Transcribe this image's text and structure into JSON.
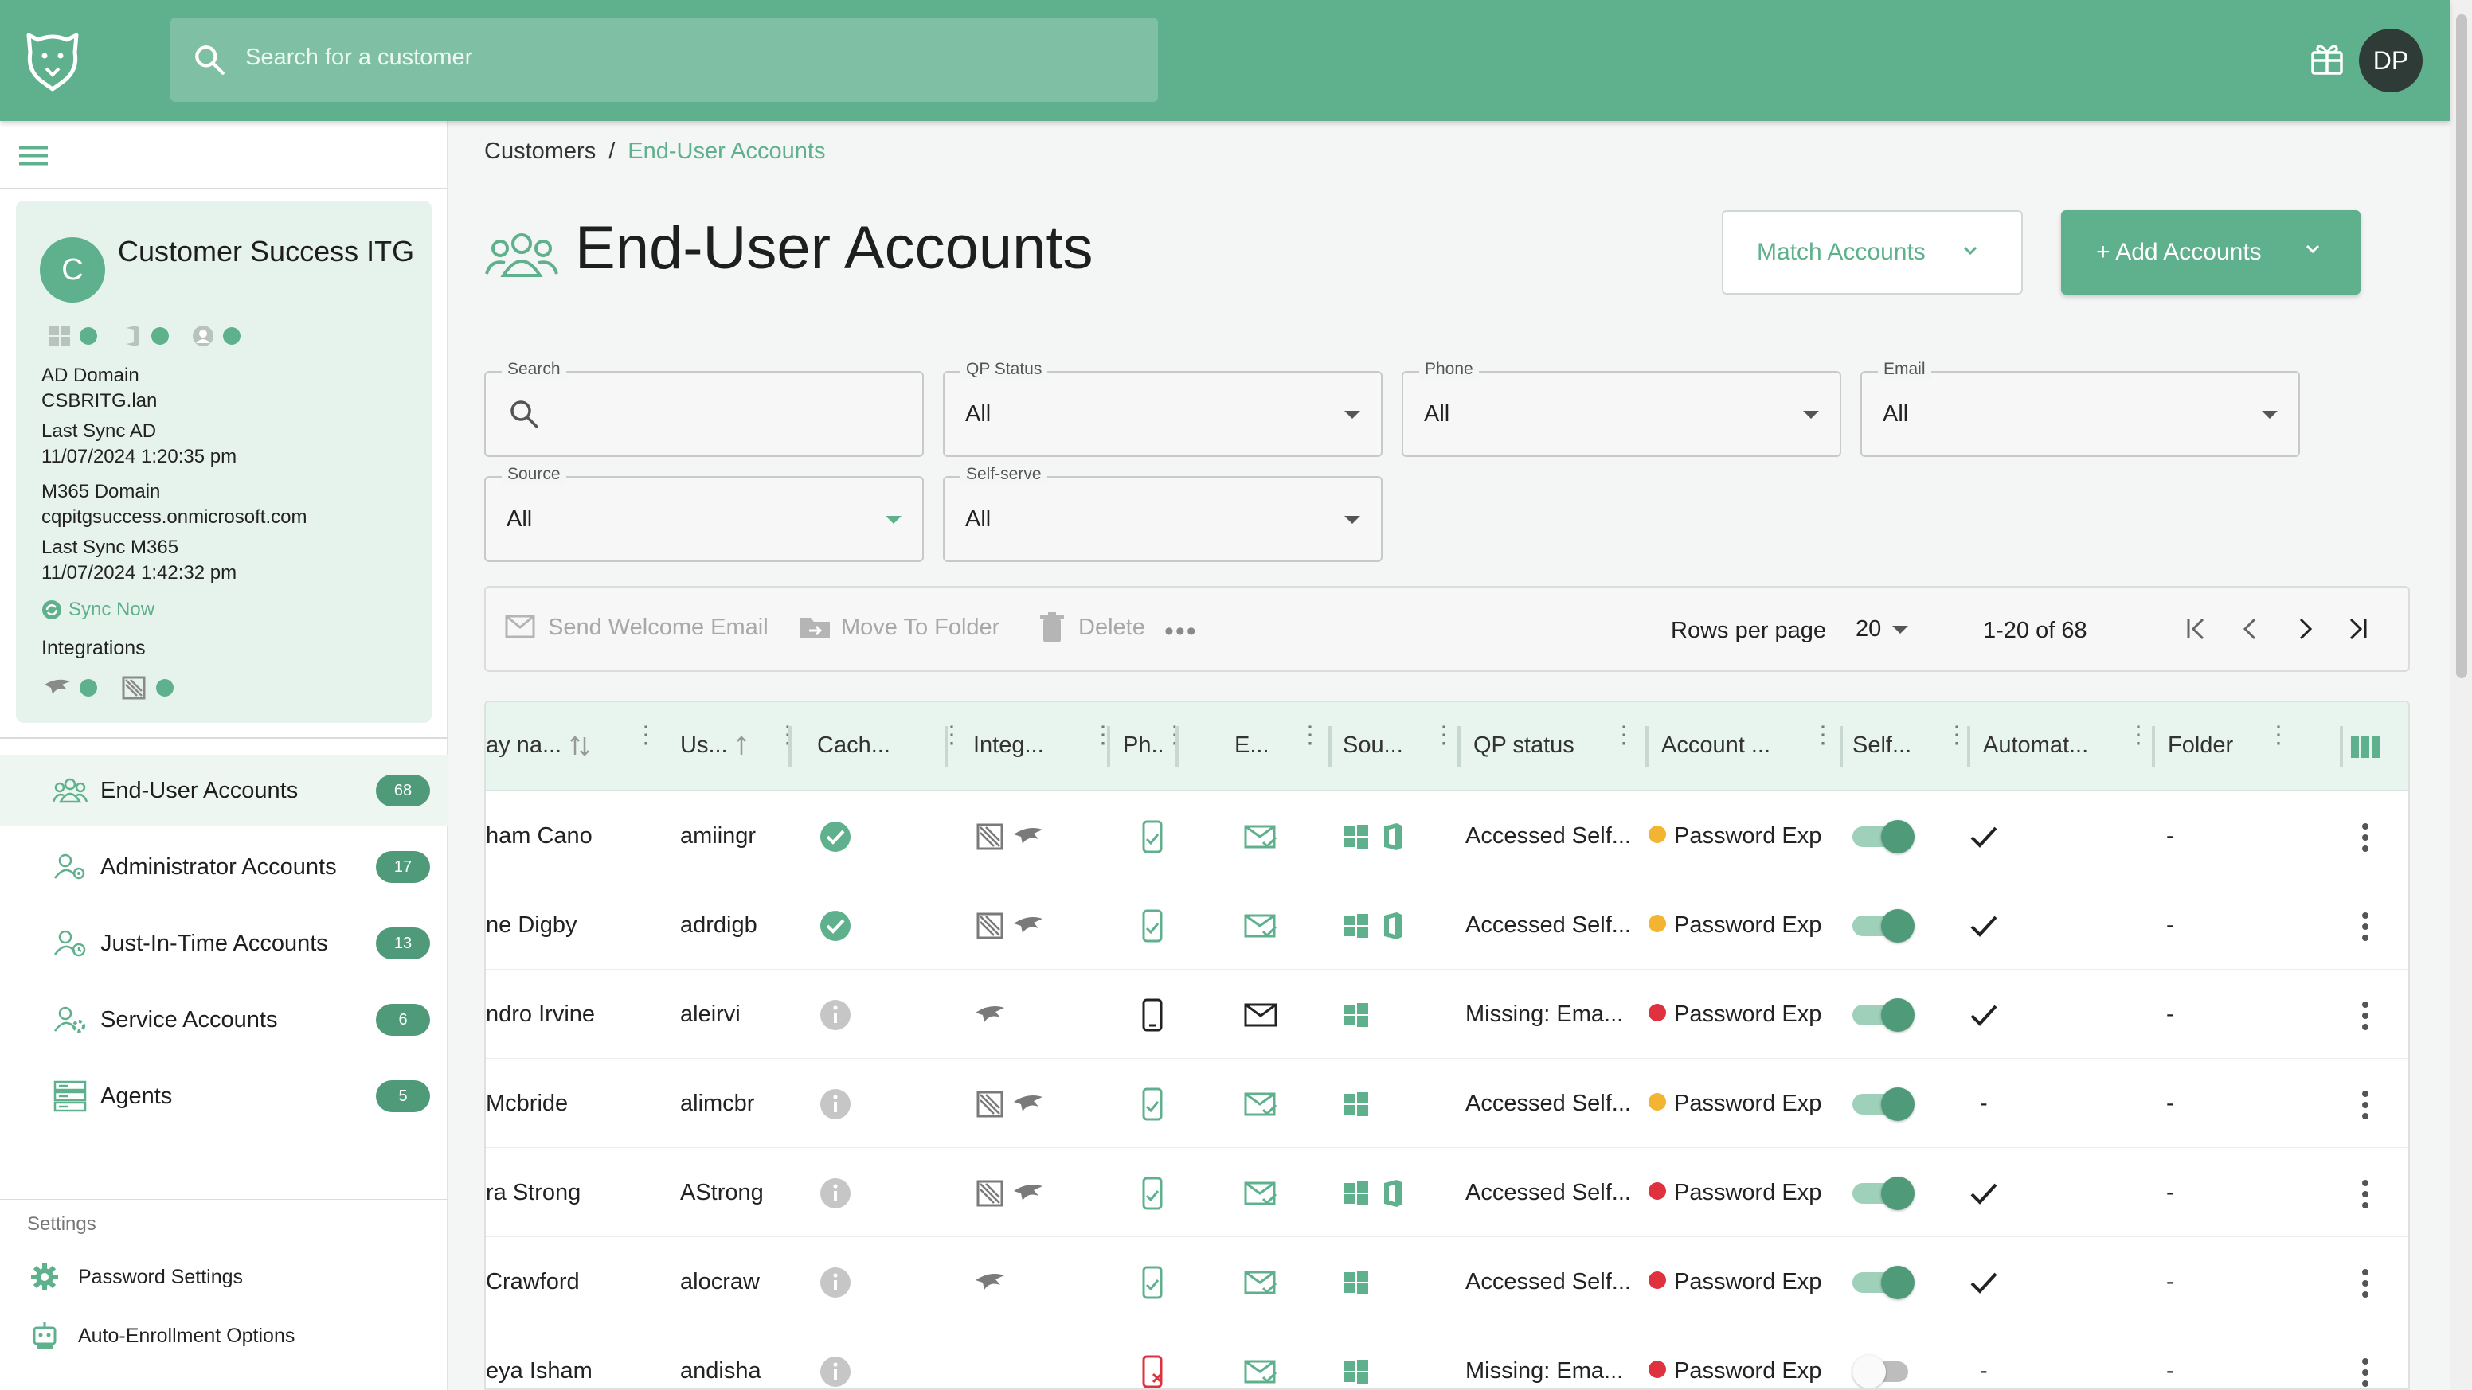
{
  "topbar": {
    "search_placeholder": "Search for a customer",
    "avatar_initials": "DP"
  },
  "customer": {
    "initial": "C",
    "name": "Customer Success ITG",
    "ad_domain_label": "AD Domain",
    "ad_domain": "CSBRITG.lan",
    "last_sync_ad_label": "Last Sync AD",
    "last_sync_ad": "11/07/2024 1:20:35 pm",
    "m365_domain_label": "M365 Domain",
    "m365_domain": "cqpitgsuccess.onmicrosoft.com",
    "last_sync_m365_label": "Last Sync M365",
    "last_sync_m365": "11/07/2024 1:42:32 pm",
    "sync_now": "Sync Now",
    "integrations_label": "Integrations"
  },
  "nav": [
    {
      "label": "End-User Accounts",
      "count": "68",
      "icon": "users-icon"
    },
    {
      "label": "Administrator Accounts",
      "count": "17",
      "icon": "admin-users-icon"
    },
    {
      "label": "Just-In-Time Accounts",
      "count": "13",
      "icon": "jit-users-icon"
    },
    {
      "label": "Service Accounts",
      "count": "6",
      "icon": "service-users-icon"
    },
    {
      "label": "Agents",
      "count": "5",
      "icon": "server-icon"
    }
  ],
  "settings": {
    "label": "Settings",
    "items": [
      {
        "label": "Password Settings",
        "icon": "gear-icon"
      },
      {
        "label": "Auto-Enrollment Options",
        "icon": "robot-icon"
      }
    ]
  },
  "breadcrumb": {
    "root": "Customers",
    "sep": "/",
    "current": "End-User Accounts"
  },
  "page": {
    "title": "End-User Accounts",
    "match_button": "Match Accounts",
    "add_button": "+ Add Accounts"
  },
  "filters": {
    "search": {
      "label": "Search",
      "value": ""
    },
    "qp_status": {
      "label": "QP Status",
      "value": "All"
    },
    "phone": {
      "label": "Phone",
      "value": "All"
    },
    "email": {
      "label": "Email",
      "value": "All"
    },
    "source": {
      "label": "Source",
      "value": "All"
    },
    "self_serve": {
      "label": "Self-serve",
      "value": "All"
    }
  },
  "toolbar": {
    "send_welcome": "Send Welcome Email",
    "move_folder": "Move To Folder",
    "delete": "Delete",
    "more": "•••",
    "rows_per_page_label": "Rows per page",
    "rows_per_page": "20",
    "range": "1-20 of 68"
  },
  "columns": [
    "ay na...",
    "Us...",
    "Cach...",
    "Integ...",
    "Ph..",
    "E...",
    "Sou...",
    "QP status",
    "Account ...",
    "Self...",
    "Automat...",
    "Folder"
  ],
  "rows": [
    {
      "name": "ham Cano",
      "user": "amiingr",
      "cache": "ok",
      "integ": [
        "ninja",
        "bird"
      ],
      "phone": "ok",
      "email": "ok",
      "source": [
        "windows",
        "office"
      ],
      "qp": "Accessed Self...",
      "acct_color": "#f2b431",
      "acct": "Password Exp",
      "self": true,
      "auto": "✓",
      "folder": "-"
    },
    {
      "name": "ne Digby",
      "user": "adrdigb",
      "cache": "ok",
      "integ": [
        "ninja",
        "bird"
      ],
      "phone": "ok",
      "email": "ok",
      "source": [
        "windows",
        "office"
      ],
      "qp": "Accessed Self...",
      "acct_color": "#f2b431",
      "acct": "Password Exp",
      "self": true,
      "auto": "✓",
      "folder": "-"
    },
    {
      "name": "ndro Irvine",
      "user": "aleirvi",
      "cache": "info",
      "integ": [
        "bird"
      ],
      "phone": "plain",
      "email": "plain",
      "source": [
        "windows"
      ],
      "qp": "Missing: Ema...",
      "acct_color": "#e0313f",
      "acct": "Password Exp",
      "self": true,
      "auto": "✓",
      "folder": "-"
    },
    {
      "name": "Mcbride",
      "user": "alimcbr",
      "cache": "info",
      "integ": [
        "ninja",
        "bird"
      ],
      "phone": "ok",
      "email": "ok",
      "source": [
        "windows"
      ],
      "qp": "Accessed Self...",
      "acct_color": "#f2b431",
      "acct": "Password Exp",
      "self": true,
      "auto": "-",
      "folder": "-"
    },
    {
      "name": "ra Strong",
      "user": "AStrong",
      "cache": "info",
      "integ": [
        "ninja",
        "bird"
      ],
      "phone": "ok",
      "email": "ok",
      "source": [
        "windows",
        "office"
      ],
      "qp": "Accessed Self...",
      "acct_color": "#e0313f",
      "acct": "Password Exp",
      "self": true,
      "auto": "✓",
      "folder": "-"
    },
    {
      "name": "Crawford",
      "user": "alocraw",
      "cache": "info",
      "integ": [
        "bird"
      ],
      "phone": "ok",
      "email": "ok",
      "source": [
        "windows"
      ],
      "qp": "Accessed Self...",
      "acct_color": "#e0313f",
      "acct": "Password Exp",
      "self": true,
      "auto": "✓",
      "folder": "-"
    },
    {
      "name": "eya Isham",
      "user": "andisha",
      "cache": "info",
      "integ": [],
      "phone": "error",
      "email": "ok",
      "source": [
        "windows"
      ],
      "qp": "Missing: Ema...",
      "acct_color": "#e0313f",
      "acct": "Password Exp",
      "self": false,
      "auto": "-",
      "folder": "-"
    }
  ]
}
